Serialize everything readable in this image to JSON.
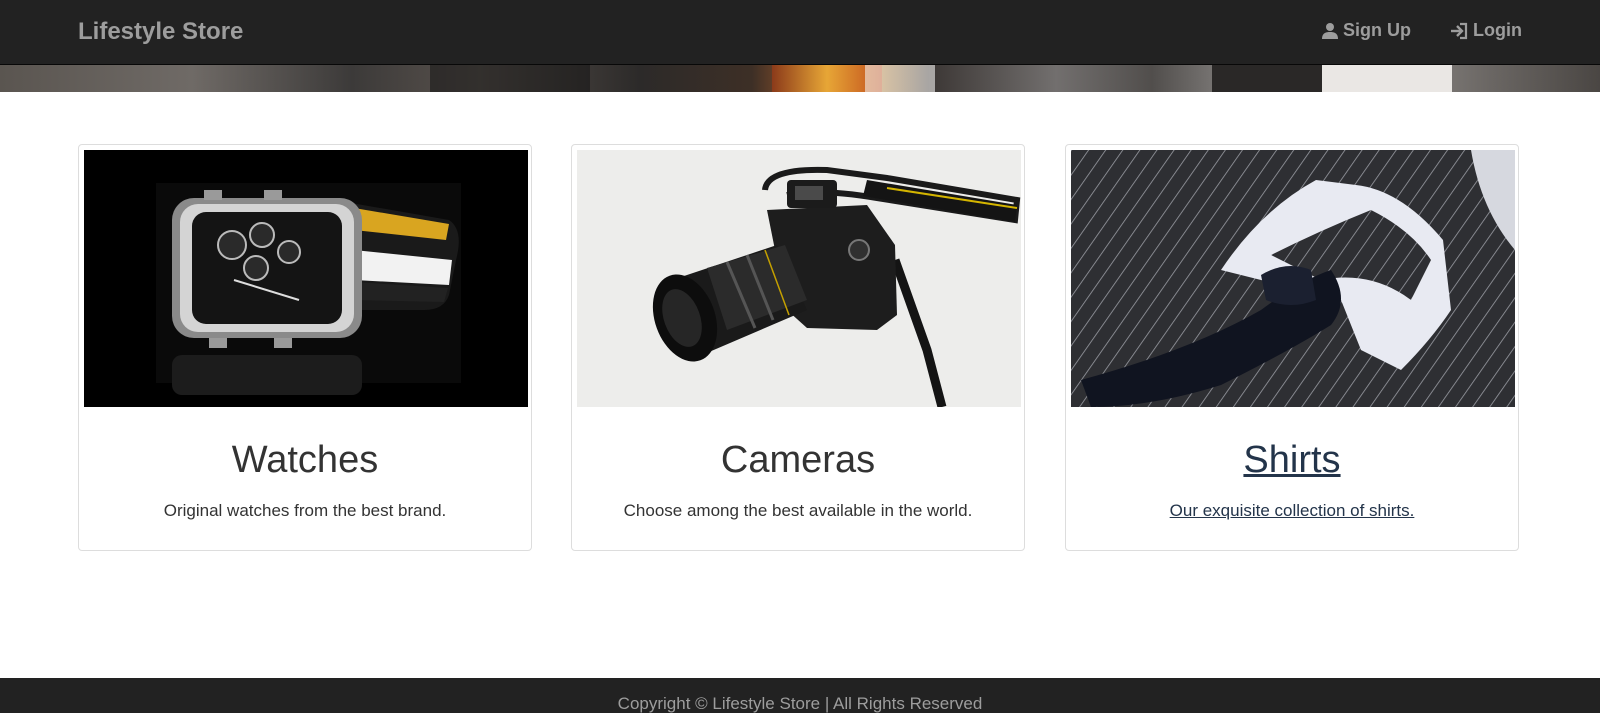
{
  "navbar": {
    "brand": "Lifestyle Store",
    "links": [
      {
        "label": "Sign Up",
        "icon": "user-icon"
      },
      {
        "label": "Login",
        "icon": "login-icon"
      }
    ]
  },
  "colors": {
    "navbar_bg": "#222222",
    "nav_text": "#9d9d9d",
    "card_border": "#dddddd",
    "text": "#333333",
    "link_hover": "#23344a"
  },
  "products": [
    {
      "title": "Watches",
      "description": "Original watches from the best brand.",
      "image": "watch-photo"
    },
    {
      "title": "Cameras",
      "description": "Choose among the best available in the world.",
      "image": "camera-photo"
    },
    {
      "title": "Shirts",
      "description": "Our exquisite collection of shirts.",
      "image": "shirt-photo",
      "hovered": true
    }
  ],
  "footer": {
    "text": "Copyright © Lifestyle Store | All Rights Reserved"
  }
}
